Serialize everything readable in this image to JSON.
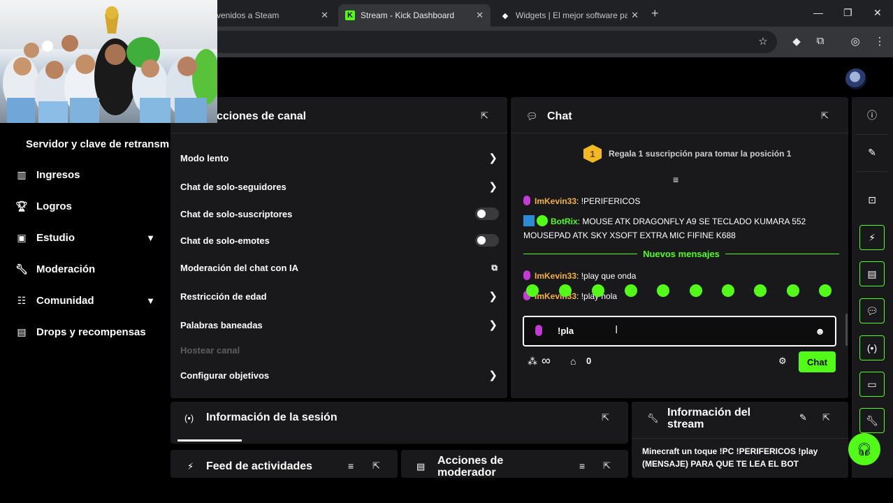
{
  "browser": {
    "tabs": [
      {
        "title": "venidos a Steam"
      },
      {
        "title": "Stream - Kick Dashboard"
      },
      {
        "title": "Widgets | El mejor software par"
      }
    ],
    "kick_favicon": "K",
    "new_tab": "+"
  },
  "sidebar": {
    "stream_key_item": "Servidor y clave de retransm",
    "items": [
      {
        "label": "Ingresos",
        "icon": "chart-icon"
      },
      {
        "label": "Logros",
        "icon": "trophy-icon"
      },
      {
        "label": "Estudio",
        "icon": "studio-icon"
      },
      {
        "label": "Moderación",
        "icon": "wrench-icon"
      },
      {
        "label": "Comunidad",
        "icon": "community-icon"
      },
      {
        "label": "Drops y recompensas",
        "icon": "drops-icon"
      }
    ]
  },
  "channel_actions": {
    "title": "cciones de canal",
    "rows": [
      {
        "label": "Modo lento",
        "control": "chevron"
      },
      {
        "label": "Chat de solo-seguidores",
        "control": "chevron"
      },
      {
        "label": "Chat de solo-suscriptores",
        "control": "toggle"
      },
      {
        "label": "Chat de solo-emotes",
        "control": "toggle"
      },
      {
        "label": "Moderación del chat con IA",
        "control": "external"
      },
      {
        "label": "Restricción de edad",
        "control": "chevron"
      },
      {
        "label": "Palabras baneadas",
        "control": "chevron"
      },
      {
        "label": "Hostear canal",
        "control": "none"
      },
      {
        "label": "Configurar objetivos",
        "control": "chevron"
      }
    ]
  },
  "chat": {
    "title": "Chat",
    "gift_rank": "1",
    "gift_text": "Regala 1 suscripción para tomar la posición 1",
    "messages_before": [
      {
        "user": "ImKevin33",
        "text": ": !PERIFERICOS"
      },
      {
        "user": "BotRix",
        "text": ": MOUSE ATK DRAGONFLY A9 SE TECLADO KUMARA 552 MOUSEPAD ATK SKY XSOFT EXTRA MIC FIFINE K688"
      }
    ],
    "new_messages_label": "Nuevos mensajes",
    "messages_after": [
      {
        "user": "ImKevin33",
        "text": ": !play que onda"
      },
      {
        "user": "ImKevin33",
        "text": ": !play hola"
      }
    ],
    "input_value": "!pla",
    "viewers_symbol": "∞",
    "store_count": "0",
    "send_label": "Chat"
  },
  "session_info": {
    "title": "Información de la sesión"
  },
  "activity_feed": {
    "title": "Feed de actividades"
  },
  "mod_actions": {
    "title_line1": "Acciones de",
    "title_line2": "moderador"
  },
  "stream_info": {
    "title_line1": "Información del",
    "title_line2": "stream",
    "stream_title_line1": "Minecraft un toque !PC !PERIFERICOS !play",
    "stream_title_line2": "(MENSAJE) PARA QUE TE LEA EL BOT"
  },
  "colors": {
    "accent": "#53fc18",
    "panel": "#19191b",
    "username": "#f4b23a",
    "sub_badge": "#c23bd4"
  }
}
